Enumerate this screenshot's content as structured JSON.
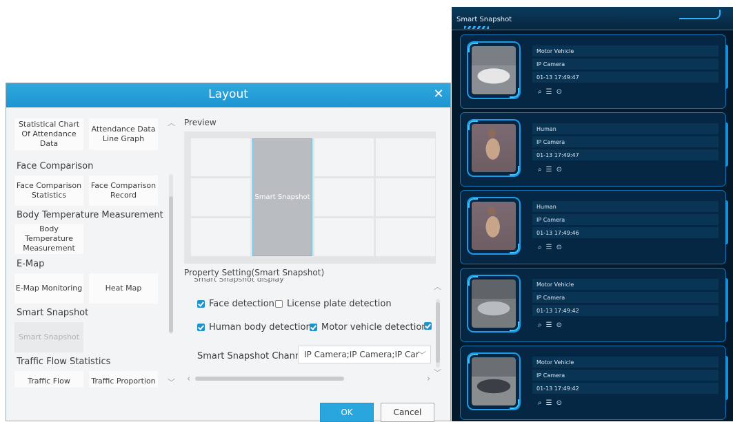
{
  "dialog": {
    "title": "Layout",
    "close_glyph": "✕",
    "categories": {
      "face_comparison": "Face Comparison",
      "body_temperature": "Body Temperature Measurement",
      "emap": "E-Map",
      "smart_snapshot": "Smart Snapshot",
      "traffic_flow_statistics": "Traffic Flow Statistics"
    },
    "tiles": {
      "stat_chart": "Statistical Chart Of Attendance Data",
      "attendance_line": "Attendance Data Line Graph",
      "face_stats": "Face Comparison Statistics",
      "face_record": "Face Comparison Record",
      "body_temp": "Body Temperature Measurement",
      "emap_monitoring": "E-Map Monitoring",
      "heat_map": "Heat Map",
      "smart_snapshot": "Smart Snapshot",
      "traffic_flow": "Traffic Flow",
      "traffic_proportion": "Traffic Proportion"
    },
    "preview_label": "Preview",
    "preview_selected": "Smart Snapshot",
    "property_label": "Property Setting(Smart Snapshot)",
    "property_clipped": "Smart Snapshot display",
    "checks": {
      "face": {
        "label": "Face detection",
        "checked": true
      },
      "plate": {
        "label": "License plate detection",
        "checked": false
      },
      "human": {
        "label": "Human body detection",
        "checked": true
      },
      "vehicle": {
        "label": "Motor vehicle detection",
        "checked": true
      }
    },
    "channel_label": "Smart Snapshot Channel",
    "channel_value": "IP Camera;IP Camera;IP Car",
    "ok": "OK",
    "cancel": "Cancel"
  },
  "snapshot": {
    "title": "Smart Snapshot",
    "cards": [
      {
        "type": "Motor Vehicle",
        "source": "IP Camera",
        "time": "01-13 17:49:47",
        "thumb": "white-sedan"
      },
      {
        "type": "Human",
        "source": "IP Camera",
        "time": "01-13 17:49:47",
        "thumb": "person-coat"
      },
      {
        "type": "Human",
        "source": "IP Camera",
        "time": "01-13 17:49:46",
        "thumb": "person-coat"
      },
      {
        "type": "Motor Vehicle",
        "source": "IP Camera",
        "time": "01-13 17:49:42",
        "thumb": "grey-sedan"
      },
      {
        "type": "Motor Vehicle",
        "source": "IP Camera",
        "time": "01-13 17:49:42",
        "thumb": "dark-sedan"
      }
    ],
    "action_icons": [
      "search-icon",
      "list-icon",
      "play-icon"
    ]
  }
}
